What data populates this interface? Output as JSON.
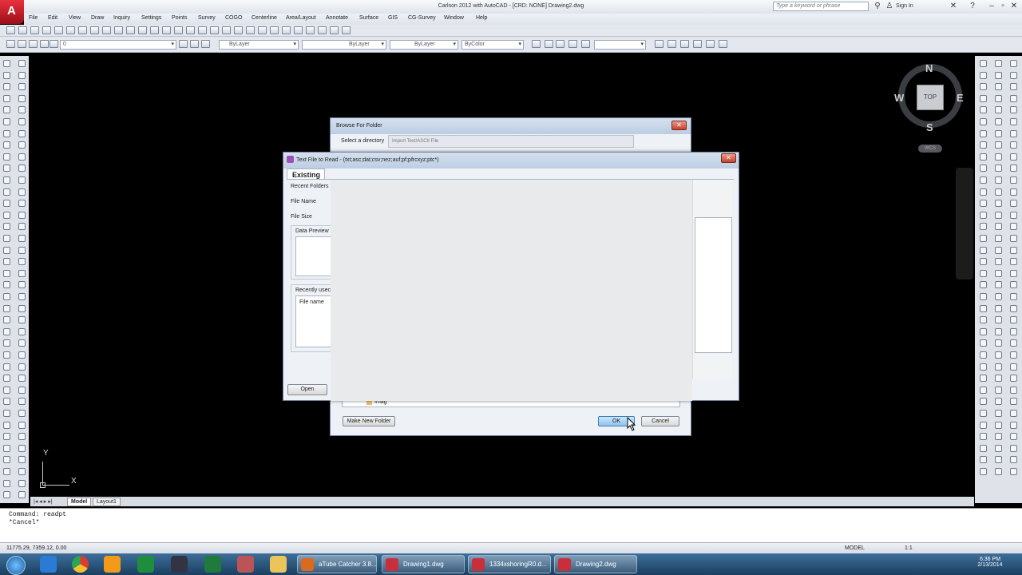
{
  "window": {
    "title": "Carlson 2012 with AutoCAD - [CRD: NONE]  Drawing2.dwg",
    "logo_letter": "A",
    "search_placeholder": "Type a keyword or phrase",
    "sign_in": "Sign In"
  },
  "menu": [
    "File",
    "Edit",
    "View",
    "Draw",
    "Inquiry",
    "Settings",
    "Points",
    "Survey",
    "COGO",
    "Centerline",
    "Area/Layout",
    "Annotate",
    "Surface",
    "GIS",
    "CG-Survey",
    "Window",
    "Help"
  ],
  "toolbar": {
    "layer_combo": "0",
    "color_combo": "ByLayer",
    "linetype_combo": "ByLayer",
    "lineweight_combo": "ByLayer",
    "plotstyle_combo": "ByColor"
  },
  "viewcube": {
    "n": "N",
    "s": "S",
    "e": "E",
    "w": "W",
    "top": "TOP",
    "wcs": "WCS"
  },
  "ucs": {
    "x": "X",
    "y": "Y"
  },
  "layout_tabs": [
    "Model",
    "Layout1"
  ],
  "command": {
    "line1": "Command: readpt",
    "line2": "*Cancel*"
  },
  "status": {
    "coords": "11775.29, 7359.12, 0.00",
    "model": "MODEL",
    "scale": "1:1"
  },
  "taskbar": {
    "time": "6:36 PM",
    "date": "2/13/2014",
    "tasks": [
      "aTube Catcher 3.8...",
      "Drawing1.dwg",
      "1334xshoringR0.d...",
      "Drawing2.dwg"
    ]
  },
  "browse_dialog": {
    "title": "Browse For Folder",
    "prompt": "Select a directory",
    "path_field": "Import Text/ASCII File",
    "partial_item": "Imag",
    "make_new_folder": "Make New Folder",
    "ok": "OK",
    "cancel": "Cancel"
  },
  "text_dialog": {
    "title": "Text File to Read - (txt;asc;dat;csv;nez;auf;pf;pfrcxyz;ptc*)",
    "tab": "Existing",
    "recent_folders": "Recent Folders",
    "file_name": "File Name",
    "file_size": "File Size",
    "data_preview": "Data Preview",
    "recently_used": "Recently usec",
    "file_name_col": "File name",
    "open": "Open"
  }
}
